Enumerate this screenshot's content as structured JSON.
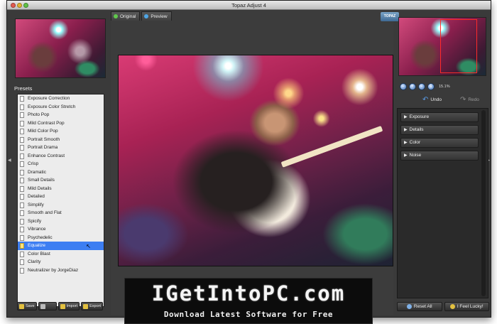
{
  "window": {
    "title": "Topaz Adjust 4"
  },
  "tabs": [
    {
      "label": "Original"
    },
    {
      "label": "Preview"
    }
  ],
  "left_panel": {
    "presets_label": "Presets",
    "presets": [
      "Exposure Correction",
      "Exposure Color Stretch",
      "Photo Pop",
      "Mild Contrast Pop",
      "Mild Color Pop",
      "Portrait Smooth",
      "Portrait Drama",
      "Enhance Contrast",
      "Crisp",
      "Dramatic",
      "Small Details",
      "Mild Details",
      "Detailed",
      "Simplify",
      "Smooth and Flat",
      "Spicify",
      "Vibrance",
      "Psychedelic",
      "Equalize",
      "Color Blast",
      "Clarity",
      "Neutralizer by JorgeDiaz"
    ],
    "selected_preset": "Equalize",
    "toolbar": {
      "save": "Save",
      "import": "Import",
      "export": "Export"
    }
  },
  "right_panel": {
    "zoom_level": "15.1%",
    "undo_label": "Undo",
    "redo_label": "Redo",
    "sections": [
      "Exposure",
      "Details",
      "Color",
      "Noise"
    ],
    "reset_all": "Reset All",
    "feel_lucky": "I Feel Lucky!"
  },
  "watermark": {
    "title": "IGetIntoPC.com",
    "subtitle": "Download Latest Software for Free"
  },
  "colors": {
    "selection": "#3d7ef2",
    "window_bg": "#3a3a3a",
    "nav_rect": "#ff2a2a"
  }
}
